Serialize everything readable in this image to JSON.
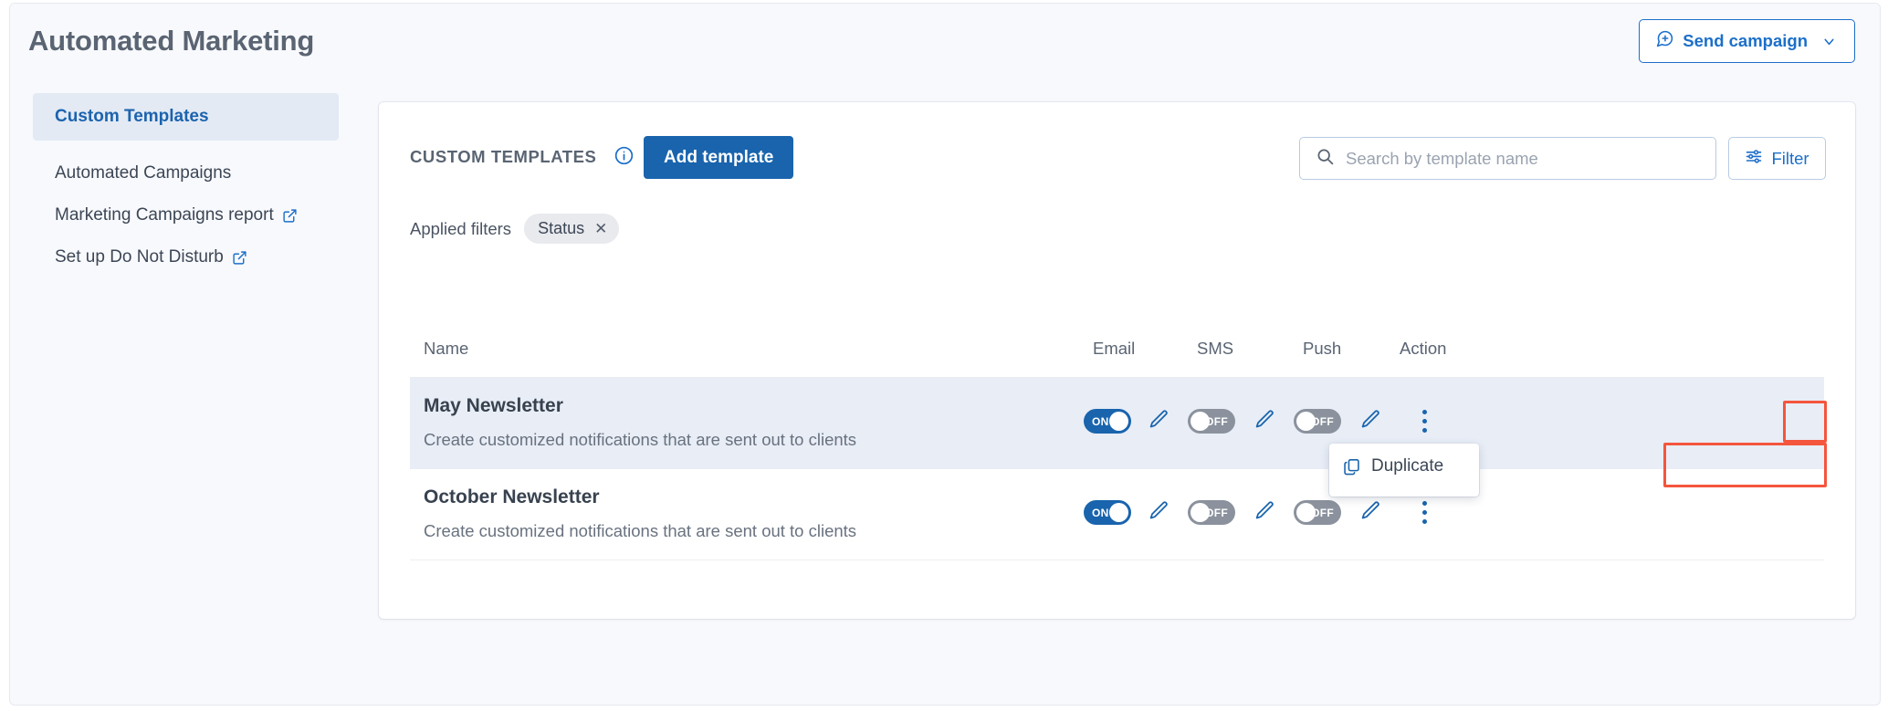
{
  "header": {
    "title": "Automated Marketing",
    "send_campaign_label": "Send campaign",
    "send_campaign_icon": "chat-plus-icon",
    "caret_icon": "chevron-down-icon"
  },
  "sidebar": {
    "items": [
      {
        "label": "Custom Templates",
        "active": true,
        "external": false
      },
      {
        "label": "Automated Campaigns",
        "active": false,
        "external": false
      },
      {
        "label": "Marketing Campaigns report",
        "active": false,
        "external": true
      },
      {
        "label": "Set up Do Not Disturb",
        "active": false,
        "external": true
      }
    ]
  },
  "toolbar": {
    "section_label": "CUSTOM TEMPLATES",
    "info_icon": "info-icon",
    "add_template_label": "Add template",
    "search": {
      "placeholder": "Search by template name",
      "value": "",
      "icon": "search-icon"
    },
    "filter_label": "Filter",
    "filter_icon": "sliders-icon"
  },
  "applied_filters": {
    "label": "Applied filters",
    "chips": [
      {
        "label": "Status",
        "remove_icon": "close-icon"
      }
    ]
  },
  "table": {
    "columns": {
      "name": "Name",
      "email": "Email",
      "sms": "SMS",
      "push": "Push",
      "action": "Action"
    },
    "rows": [
      {
        "name": "May Newsletter",
        "description": "Create customized notifications that are sent out to clients",
        "email": {
          "state": "ON"
        },
        "sms": {
          "state": "OFF"
        },
        "push": {
          "state": "OFF"
        },
        "highlighted": true
      },
      {
        "name": "October Newsletter",
        "description": "Create customized notifications that are sent out to clients",
        "email": {
          "state": "ON"
        },
        "sms": {
          "state": "OFF"
        },
        "push": {
          "state": "OFF"
        },
        "highlighted": false
      }
    ]
  },
  "action_menu": {
    "open": true,
    "items": [
      {
        "label": "Duplicate",
        "icon": "copy-icon"
      }
    ]
  },
  "colors": {
    "primary": "#1964ad",
    "link": "#1c6fc9",
    "toggle_on": "#1964ad",
    "toggle_off": "#8b929d",
    "row_highlight": "#e8edf6",
    "annotation": "#f4553d",
    "page_bg": "#f8f9fc"
  }
}
